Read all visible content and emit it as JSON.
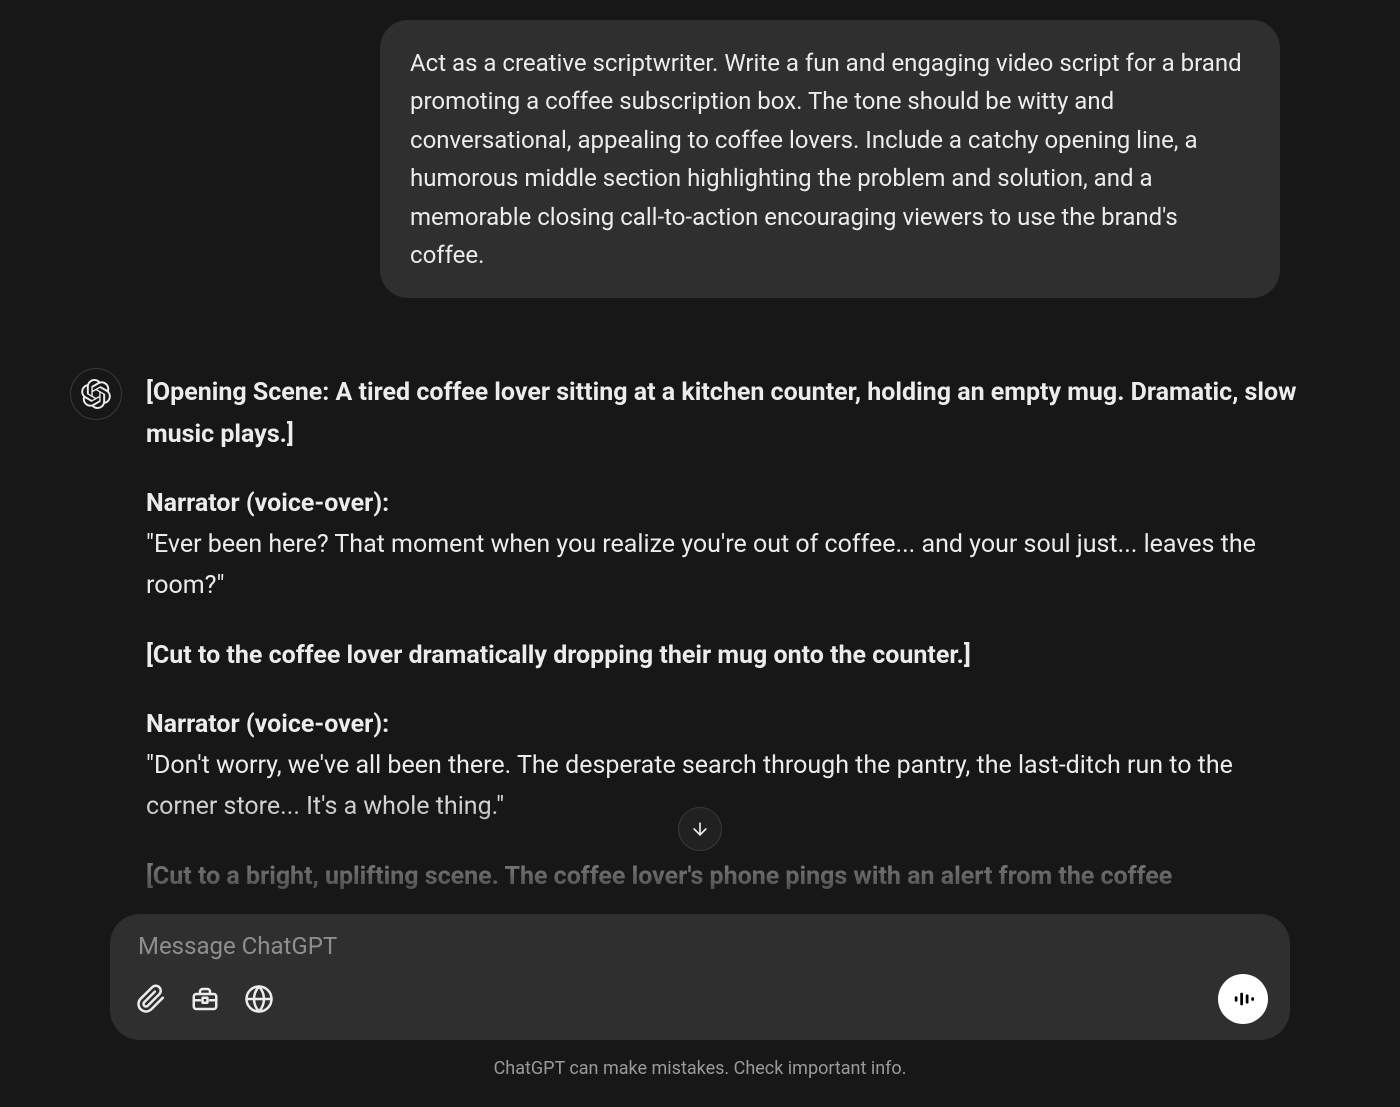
{
  "user_message": "Act as a creative scriptwriter. Write a fun and engaging video script for a brand promoting a coffee subscription box. The tone should be witty and conversational, appealing to coffee lovers. Include a catchy opening line, a humorous middle section highlighting the problem and solution, and a memorable closing call-to-action encouraging viewers to use the brand's coffee.",
  "assistant_response": {
    "p1_bold": "[Opening Scene: A tired coffee lover sitting at a kitchen counter, holding an empty mug. Dramatic, slow music plays.]",
    "p2_bold": "Narrator (voice-over):",
    "p2_text": "\"Ever been here? That moment when you realize you're out of coffee... and your soul just... leaves the room?\"",
    "p3_bold": "[Cut to the coffee lover dramatically dropping their mug onto the counter.]",
    "p4_bold": "Narrator (voice-over):",
    "p4_text": "\"Don't worry, we've all been there. The desperate search through the pantry, the last-ditch run to the corner store... It's a whole thing.\"",
    "p5_bold": "[Cut to a bright, uplifting scene. The coffee lover's phone pings with an alert from the coffee"
  },
  "input": {
    "placeholder": "Message ChatGPT"
  },
  "disclaimer": "ChatGPT can make mistakes. Check important info."
}
